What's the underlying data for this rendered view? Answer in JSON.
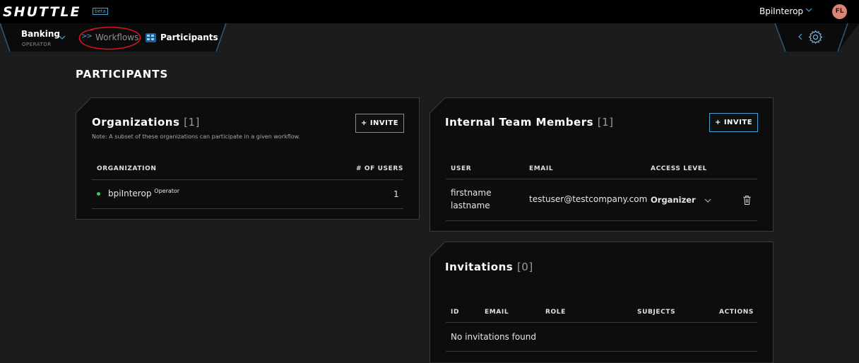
{
  "app": {
    "logo": "SHUTTLE",
    "badge": "beta"
  },
  "user": {
    "name": "BpiInterop",
    "initials": "FL"
  },
  "workspace": {
    "name": "Banking",
    "role": "OPERATOR"
  },
  "breadcrumb": {
    "separator": ">>",
    "workflows": "Workflows",
    "current": "Participants"
  },
  "page": {
    "title": "PARTICIPANTS"
  },
  "organizations": {
    "title": "Organizations",
    "count": "[1]",
    "note": "Note: A subset of these organizations can participate in a given workflow.",
    "invite_label": "+ INVITE",
    "columns": [
      "ORGANIZATION",
      "# OF USERS"
    ],
    "rows": [
      {
        "name": "bpiInterop",
        "role": "Operator",
        "users": "1",
        "status_color": "#41c26b"
      }
    ]
  },
  "team": {
    "title": "Internal Team Members",
    "count": "[1]",
    "invite_label": "+ INVITE",
    "columns": [
      "USER",
      "EMAIL",
      "ACCESS LEVEL"
    ],
    "rows": [
      {
        "first": "firstname",
        "last": "lastname",
        "email": "testuser@testcompany.com",
        "access": "Organizer"
      }
    ]
  },
  "invitations": {
    "title": "Invitations",
    "count": "[0]",
    "columns": [
      "ID",
      "EMAIL",
      "ROLE",
      "SUBJECTS",
      "ACTIONS"
    ],
    "empty": "No invitations found"
  },
  "colors": {
    "accent": "#4aa3d8",
    "annotation": "#d0161a",
    "avatar": "#d9857a"
  }
}
